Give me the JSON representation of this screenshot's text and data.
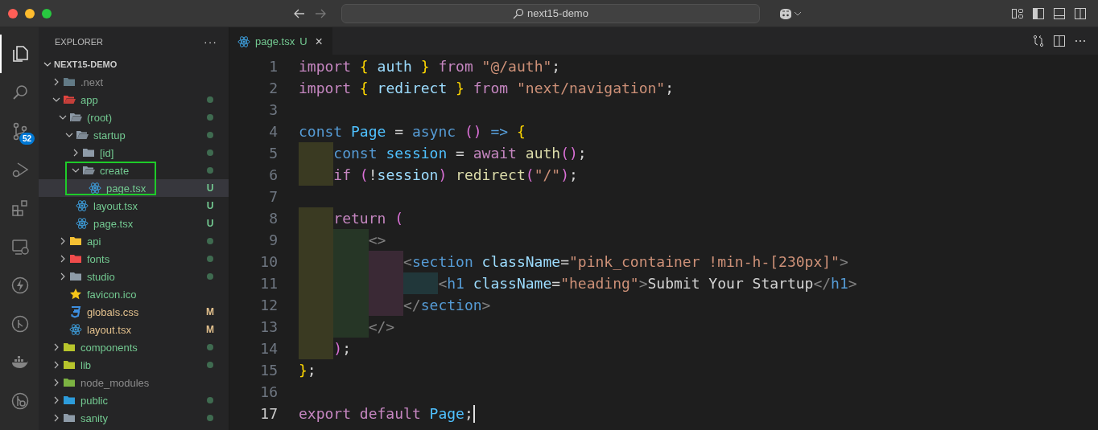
{
  "window": {
    "search": "next15-demo"
  },
  "activity_bar": {
    "items": [
      {
        "selected": true
      },
      {
        "selected": false
      },
      {
        "selected": false,
        "badge": "52"
      },
      {
        "selected": false
      },
      {
        "selected": false
      },
      {
        "selected": false
      },
      {
        "selected": false
      },
      {
        "selected": false
      },
      {
        "selected": false
      },
      {
        "selected": false
      }
    ]
  },
  "explorer": {
    "title": "EXPLORER",
    "more": "···",
    "root": {
      "label": "NEXT15-DEMO",
      "expanded": true
    },
    "items": [
      {
        "label": ".next",
        "kind": "nextfolder",
        "expanded": false,
        "color": "#8c8c8c",
        "selected": false,
        "framed": false
      },
      {
        "label": "app",
        "kind": "appfolder",
        "expanded": true,
        "color": "#73c991",
        "selected": false,
        "framed": false,
        "children": [
          {
            "label": "(root)",
            "kind": "folder",
            "expanded": true,
            "color": "#73c991",
            "selected": false,
            "framed": false,
            "children": [
              {
                "label": "startup",
                "kind": "folder",
                "expanded": true,
                "color": "#73c991",
                "selected": false,
                "framed": false,
                "children": [
                  {
                    "label": "[id]",
                    "kind": "folder",
                    "expanded": false,
                    "color": "#73c991",
                    "selected": false,
                    "framed": false
                  },
                  {
                    "label": "create",
                    "kind": "folder",
                    "expanded": true,
                    "color": "#73c991",
                    "selected": false,
                    "framed": true,
                    "children": [
                      {
                        "label": "page.tsx",
                        "kind": "react",
                        "color": "#73c991",
                        "badge": "U",
                        "selected": true,
                        "framed": false
                      }
                    ]
                  }
                ]
              },
              {
                "label": "layout.tsx",
                "kind": "react",
                "color": "#73c991",
                "badge": "U",
                "selected": false,
                "framed": false
              },
              {
                "label": "page.tsx",
                "kind": "react",
                "color": "#73c991",
                "badge": "U",
                "selected": false,
                "framed": false
              }
            ]
          },
          {
            "label": "api",
            "kind": "apifolder",
            "expanded": false,
            "color": "#73c991",
            "selected": false,
            "framed": false
          },
          {
            "label": "fonts",
            "kind": "fontsfolder",
            "expanded": false,
            "color": "#73c991",
            "selected": false,
            "framed": false
          },
          {
            "label": "studio",
            "kind": "folder",
            "expanded": false,
            "color": "#73c991",
            "selected": false,
            "framed": false
          },
          {
            "label": "favicon.ico",
            "kind": "star",
            "color": "#73c991",
            "selected": false,
            "framed": false
          },
          {
            "label": "globals.css",
            "kind": "css",
            "color": "#e2c08d",
            "badge": "M",
            "selected": false,
            "framed": false
          },
          {
            "label": "layout.tsx",
            "kind": "react",
            "color": "#e2c08d",
            "badge": "M",
            "selected": false,
            "framed": false
          }
        ]
      },
      {
        "label": "components",
        "kind": "componentsfolder",
        "expanded": false,
        "color": "#73c991",
        "selected": false,
        "framed": false
      },
      {
        "label": "lib",
        "kind": "libfolder",
        "expanded": false,
        "color": "#73c991",
        "selected": false,
        "framed": false
      },
      {
        "label": "node_modules",
        "kind": "nodefolder",
        "expanded": false,
        "color": "#8c8c8c",
        "selected": false,
        "framed": false
      },
      {
        "label": "public",
        "kind": "publicfolder",
        "expanded": false,
        "color": "#73c991",
        "selected": false,
        "framed": false
      },
      {
        "label": "sanity",
        "kind": "folder",
        "expanded": false,
        "color": "#73c991",
        "selected": false,
        "framed": false
      }
    ]
  },
  "tabs": [
    {
      "label": "page.tsx",
      "badge": "U",
      "close": "×",
      "selected": true
    }
  ],
  "editor": {
    "lines": [
      {
        "number": "1",
        "current": false,
        "tokens": [
          {
            "kind": "control",
            "text": "import "
          },
          {
            "kind": "b1",
            "text": "{ "
          },
          {
            "kind": "var",
            "text": "auth "
          },
          {
            "kind": "b1",
            "text": "} "
          },
          {
            "kind": "control",
            "text": "from "
          },
          {
            "kind": "string",
            "text": "\"@/auth\""
          },
          {
            "kind": "plain",
            "text": ";"
          }
        ]
      },
      {
        "number": "2",
        "current": false,
        "tokens": [
          {
            "kind": "control",
            "text": "import "
          },
          {
            "kind": "b1",
            "text": "{ "
          },
          {
            "kind": "var",
            "text": "redirect "
          },
          {
            "kind": "b1",
            "text": "} "
          },
          {
            "kind": "control",
            "text": "from "
          },
          {
            "kind": "string",
            "text": "\"next/navigation\""
          },
          {
            "kind": "plain",
            "text": ";"
          }
        ]
      },
      {
        "number": "3",
        "current": false
      },
      {
        "number": "4",
        "current": false,
        "tokens": [
          {
            "kind": "storage",
            "text": "const "
          },
          {
            "kind": "constant",
            "text": "Page "
          },
          {
            "kind": "plain",
            "text": "= "
          },
          {
            "kind": "storage",
            "text": "async "
          },
          {
            "kind": "b2",
            "text": "() "
          },
          {
            "kind": "storage",
            "text": "=> "
          },
          {
            "kind": "b1",
            "text": "{"
          }
        ]
      },
      {
        "number": "5",
        "current": false,
        "guides": [
          {
            "color": "#3a3a22"
          }
        ],
        "tokens": [
          {
            "kind": "storage",
            "text": "const "
          },
          {
            "kind": "constant",
            "text": "session "
          },
          {
            "kind": "plain",
            "text": "= "
          },
          {
            "kind": "control",
            "text": "await "
          },
          {
            "kind": "function",
            "text": "auth"
          },
          {
            "kind": "b2",
            "text": "()"
          },
          {
            "kind": "plain",
            "text": ";"
          }
        ]
      },
      {
        "number": "6",
        "current": false,
        "guides": [
          {
            "color": "#3a3a22"
          }
        ],
        "tokens": [
          {
            "kind": "control",
            "text": "if "
          },
          {
            "kind": "b2",
            "text": "("
          },
          {
            "kind": "plain",
            "text": "!"
          },
          {
            "kind": "var",
            "text": "session"
          },
          {
            "kind": "b2",
            "text": ") "
          },
          {
            "kind": "function",
            "text": "redirect"
          },
          {
            "kind": "b2",
            "text": "("
          },
          {
            "kind": "string",
            "text": "\"/\""
          },
          {
            "kind": "b2",
            "text": ")"
          },
          {
            "kind": "plain",
            "text": ";"
          }
        ]
      },
      {
        "number": "7",
        "current": false
      },
      {
        "number": "8",
        "current": false,
        "guides": [
          {
            "color": "#3a3a22"
          }
        ],
        "tokens": [
          {
            "kind": "control",
            "text": "return "
          },
          {
            "kind": "b2",
            "text": "("
          }
        ]
      },
      {
        "number": "9",
        "current": false,
        "guides": [
          {
            "color": "#3a3a22"
          },
          {
            "color": "#263626"
          }
        ],
        "tokens": [
          {
            "kind": "tag",
            "text": "<>"
          }
        ]
      },
      {
        "number": "10",
        "current": false,
        "guides": [
          {
            "color": "#3a3a22"
          },
          {
            "color": "#263626"
          },
          {
            "color": "#3a2935"
          }
        ],
        "tokens": [
          {
            "kind": "tag",
            "text": "<"
          },
          {
            "kind": "tagname",
            "text": "section "
          },
          {
            "kind": "attr",
            "text": "className"
          },
          {
            "kind": "plain",
            "text": "="
          },
          {
            "kind": "string",
            "text": "\"pink_container !min-h-[230px]\""
          },
          {
            "kind": "tag",
            "text": ">"
          }
        ]
      },
      {
        "number": "11",
        "current": false,
        "guides": [
          {
            "color": "#3a3a22"
          },
          {
            "color": "#263626"
          },
          {
            "color": "#3a2935"
          },
          {
            "color": "#21373a"
          }
        ],
        "tokens": [
          {
            "kind": "tag",
            "text": "<"
          },
          {
            "kind": "tagname",
            "text": "h1 "
          },
          {
            "kind": "attr",
            "text": "className"
          },
          {
            "kind": "plain",
            "text": "="
          },
          {
            "kind": "string",
            "text": "\"heading\""
          },
          {
            "kind": "tag",
            "text": ">"
          },
          {
            "kind": "plain",
            "text": "Submit Your Startup"
          },
          {
            "kind": "tag",
            "text": "</"
          },
          {
            "kind": "tagname",
            "text": "h1"
          },
          {
            "kind": "tag",
            "text": ">"
          }
        ]
      },
      {
        "number": "12",
        "current": false,
        "guides": [
          {
            "color": "#3a3a22"
          },
          {
            "color": "#263626"
          },
          {
            "color": "#3a2935"
          }
        ],
        "tokens": [
          {
            "kind": "tag",
            "text": "</"
          },
          {
            "kind": "tagname",
            "text": "section"
          },
          {
            "kind": "tag",
            "text": ">"
          }
        ]
      },
      {
        "number": "13",
        "current": false,
        "guides": [
          {
            "color": "#3a3a22"
          },
          {
            "color": "#263626"
          }
        ],
        "tokens": [
          {
            "kind": "tag",
            "text": "</>"
          }
        ]
      },
      {
        "number": "14",
        "current": false,
        "guides": [
          {
            "color": "#3a3a22"
          }
        ],
        "tokens": [
          {
            "kind": "b2",
            "text": ")"
          },
          {
            "kind": "plain",
            "text": ";"
          }
        ]
      },
      {
        "number": "15",
        "current": false,
        "tokens": [
          {
            "kind": "b1",
            "text": "}"
          },
          {
            "kind": "plain",
            "text": ";"
          }
        ]
      },
      {
        "number": "16",
        "current": false
      },
      {
        "number": "17",
        "current": true,
        "tokens": [
          {
            "kind": "control",
            "text": "export "
          },
          {
            "kind": "control",
            "text": "default "
          },
          {
            "kind": "constant",
            "text": "Page"
          },
          {
            "kind": "plain",
            "text": ";"
          }
        ]
      }
    ]
  }
}
